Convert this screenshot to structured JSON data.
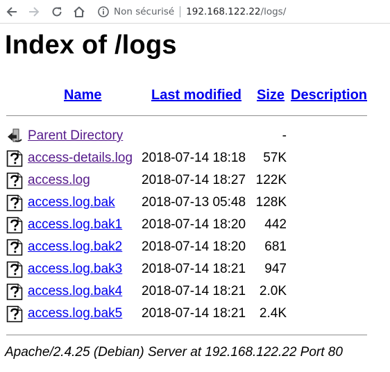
{
  "browser": {
    "security_status": "Non sécurisé",
    "url_host": "192.168.122.22",
    "url_path": "/logs/"
  },
  "page": {
    "title": "Index of /logs",
    "columns": {
      "name": "Name",
      "last_modified": "Last modified",
      "size": "Size",
      "description": "Description"
    },
    "rows": [
      {
        "name": "Parent Directory",
        "modified": "",
        "size": "-",
        "description": "",
        "icon": "back-icon",
        "visited": true
      },
      {
        "name": "access-details.log",
        "modified": "2018-07-14 18:18",
        "size": "57K",
        "description": "",
        "icon": "unknown-file-icon",
        "visited": true
      },
      {
        "name": "access.log",
        "modified": "2018-07-14 18:27",
        "size": "122K",
        "description": "",
        "icon": "unknown-file-icon",
        "visited": true
      },
      {
        "name": "access.log.bak",
        "modified": "2018-07-13 05:48",
        "size": "128K",
        "description": "",
        "icon": "unknown-file-icon",
        "visited": false
      },
      {
        "name": "access.log.bak1",
        "modified": "2018-07-14 18:20",
        "size": "442",
        "description": "",
        "icon": "unknown-file-icon",
        "visited": false
      },
      {
        "name": "access.log.bak2",
        "modified": "2018-07-14 18:20",
        "size": "681",
        "description": "",
        "icon": "unknown-file-icon",
        "visited": false
      },
      {
        "name": "access.log.bak3",
        "modified": "2018-07-14 18:21",
        "size": "947",
        "description": "",
        "icon": "unknown-file-icon",
        "visited": false
      },
      {
        "name": "access.log.bak4",
        "modified": "2018-07-14 18:21",
        "size": "2.0K",
        "description": "",
        "icon": "unknown-file-icon",
        "visited": false
      },
      {
        "name": "access.log.bak5",
        "modified": "2018-07-14 18:21",
        "size": "2.4K",
        "description": "",
        "icon": "unknown-file-icon",
        "visited": false
      }
    ],
    "footer": "Apache/2.4.25 (Debian) Server at 192.168.122.22 Port 80"
  },
  "colors": {
    "link": "#0000ee",
    "visited_link": "#551a8b"
  }
}
